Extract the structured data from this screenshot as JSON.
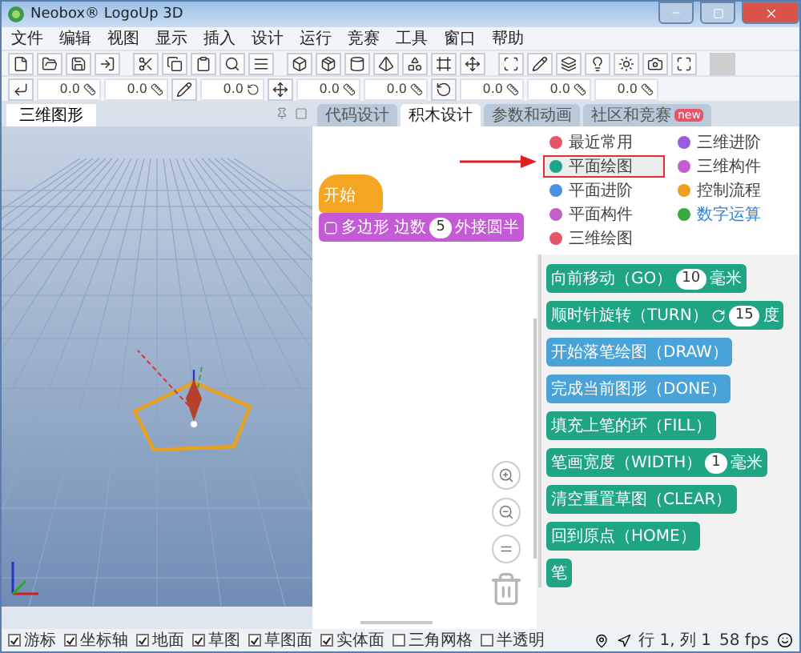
{
  "window": {
    "title": "Neobox® LogoUp 3D"
  },
  "menu": [
    "文件",
    "编辑",
    "视图",
    "显示",
    "插入",
    "设计",
    "运行",
    "竞赛",
    "工具",
    "窗口",
    "帮助"
  ],
  "toolbar_fields": [
    "0.0",
    "0.0",
    "0.0",
    "0.0",
    "0.0",
    "0.0",
    "0.0",
    "0.0"
  ],
  "viewport": {
    "tab": "三维图形"
  },
  "tabs": [
    {
      "label": "代码设计",
      "selected": false
    },
    {
      "label": "积木设计",
      "selected": true
    },
    {
      "label": "参数和动画",
      "selected": false
    },
    {
      "label": "社区和竞赛",
      "selected": false,
      "badge": "new"
    }
  ],
  "categories": [
    {
      "label": "最近常用",
      "color": "#e8546a",
      "selected": false,
      "hovered": false
    },
    {
      "label": "三维进阶",
      "color": "#9a5be0",
      "selected": false,
      "hovered": false
    },
    {
      "label": "平面绘图",
      "color": "#1aa589",
      "selected": true,
      "hovered": false
    },
    {
      "label": "三维构件",
      "color": "#c35dd0",
      "selected": false,
      "hovered": false
    },
    {
      "label": "平面进阶",
      "color": "#4a8fe0",
      "selected": false,
      "hovered": false
    },
    {
      "label": "控制流程",
      "color": "#f0a020",
      "selected": false,
      "hovered": false
    },
    {
      "label": "平面构件",
      "color": "#c060c8",
      "selected": false,
      "hovered": false
    },
    {
      "label": "数字运算",
      "color": "#3aa840",
      "selected": false,
      "hovered": true
    },
    {
      "label": "三维绘图",
      "color": "#e8546a",
      "selected": false,
      "hovered": false
    }
  ],
  "workspace_blocks": [
    {
      "kind": "hat",
      "color": "#f5a623",
      "parts": [
        {
          "kind": "text",
          "text": "开始"
        }
      ]
    },
    {
      "kind": "statement",
      "color": "#c45ad6",
      "parts": [
        {
          "kind": "toggle"
        },
        {
          "kind": "text",
          "text": "多边形 边数"
        },
        {
          "kind": "input",
          "text": "5"
        },
        {
          "kind": "text",
          "text": "外接圆半"
        }
      ]
    }
  ],
  "palette_blocks": [
    {
      "color": "#1fa584",
      "parts": [
        {
          "kind": "text",
          "text": "向前移动（GO）"
        },
        {
          "kind": "input",
          "text": "10"
        },
        {
          "kind": "text",
          "text": "毫米"
        }
      ]
    },
    {
      "color": "#1fa584",
      "parts": [
        {
          "kind": "text",
          "text": "顺时针旋转（TURN）"
        },
        {
          "kind": "rotation"
        },
        {
          "kind": "input",
          "text": "15"
        },
        {
          "kind": "text",
          "text": "度"
        }
      ]
    },
    {
      "color": "#4aa3d8",
      "parts": [
        {
          "kind": "text",
          "text": "开始落笔绘图（DRAW）"
        }
      ]
    },
    {
      "color": "#4aa3d8",
      "parts": [
        {
          "kind": "text",
          "text": "完成当前图形（DONE）"
        }
      ]
    },
    {
      "color": "#1fa584",
      "parts": [
        {
          "kind": "text",
          "text": "填充上笔的环（FILL）"
        }
      ]
    },
    {
      "color": "#1fa584",
      "parts": [
        {
          "kind": "text",
          "text": "笔画宽度（WIDTH）"
        },
        {
          "kind": "input",
          "text": "1"
        },
        {
          "kind": "text",
          "text": "毫米"
        }
      ]
    },
    {
      "color": "#1fa584",
      "parts": [
        {
          "kind": "text",
          "text": "清空重置草图（CLEAR）"
        }
      ]
    },
    {
      "color": "#1fa584",
      "parts": [
        {
          "kind": "text",
          "text": "回到原点（HOME）"
        }
      ]
    },
    {
      "color": "#1fa584",
      "parts": [
        {
          "kind": "text",
          "text": "笔"
        }
      ]
    }
  ],
  "status": {
    "checkboxes": [
      {
        "label": "游标",
        "checked": true
      },
      {
        "label": "坐标轴",
        "checked": true
      },
      {
        "label": "地面",
        "checked": true
      },
      {
        "label": "草图",
        "checked": true
      },
      {
        "label": "草图面",
        "checked": true
      },
      {
        "label": "实体面",
        "checked": true
      },
      {
        "label": "三角网格",
        "checked": false
      },
      {
        "label": "半透明",
        "checked": false
      }
    ],
    "position": "行 1, 列 1",
    "fps": "58 fps"
  }
}
